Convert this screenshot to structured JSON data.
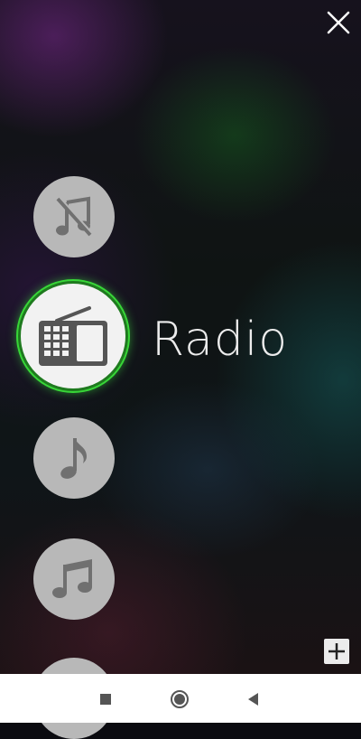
{
  "app": {
    "close_icon": "close-icon",
    "add_icon": "add-icon"
  },
  "menu": {
    "items": [
      {
        "icon": "music-off-icon",
        "active": false
      },
      {
        "icon": "radio-icon",
        "active": true,
        "label": "Radio"
      },
      {
        "icon": "music-note-icon",
        "active": false
      },
      {
        "icon": "music-notes-icon",
        "active": false
      },
      {
        "icon": "partial-item-icon",
        "active": false
      }
    ],
    "active_label": "Radio"
  },
  "colors": {
    "inactive_circle": "#b8b8b8",
    "active_circle": "#f2f2f2",
    "active_ring": "#38d638",
    "icon_gray": "#707070",
    "label_text": "#ececec"
  },
  "navbar": {
    "recents_icon": "square-icon",
    "home_icon": "circle-home-icon",
    "back_icon": "back-triangle-icon"
  }
}
